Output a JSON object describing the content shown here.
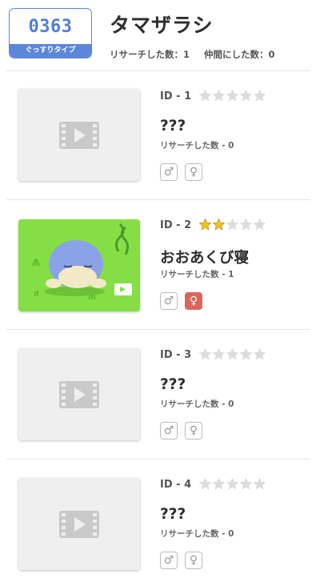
{
  "header": {
    "number": "0363",
    "type_label": "ぐっすりタイプ",
    "title": "タマザラシ",
    "research_count": "リサーチした数：1",
    "friend_count": "仲間にした数：0"
  },
  "colors": {
    "accent_blue": "#5b86d9",
    "star_gold": "#f4c51c",
    "star_empty": "#dcdcdc",
    "female_active": "#d9675d"
  },
  "entries": [
    {
      "id": "ID - 1",
      "stars": 0,
      "name": "???",
      "research": "リサーチした数 - 0",
      "male": "♂",
      "female": "♀",
      "male_active": false,
      "female_active": false,
      "thumbnail": "video-placeholder"
    },
    {
      "id": "ID - 2",
      "stars": 2,
      "name": "おおあくび寝",
      "research": "リサーチした数 - 1",
      "male": "♂",
      "female": "♀",
      "male_active": false,
      "female_active": true,
      "thumbnail": "spheal-sleeping-image"
    },
    {
      "id": "ID - 3",
      "stars": 0,
      "name": "???",
      "research": "リサーチした数 - 0",
      "male": "♂",
      "female": "♀",
      "male_active": false,
      "female_active": false,
      "thumbnail": "video-placeholder"
    },
    {
      "id": "ID - 4",
      "stars": 0,
      "name": "???",
      "research": "リサーチした数 - 0",
      "male": "♂",
      "female": "♀",
      "male_active": false,
      "female_active": false,
      "thumbnail": "video-placeholder"
    }
  ]
}
